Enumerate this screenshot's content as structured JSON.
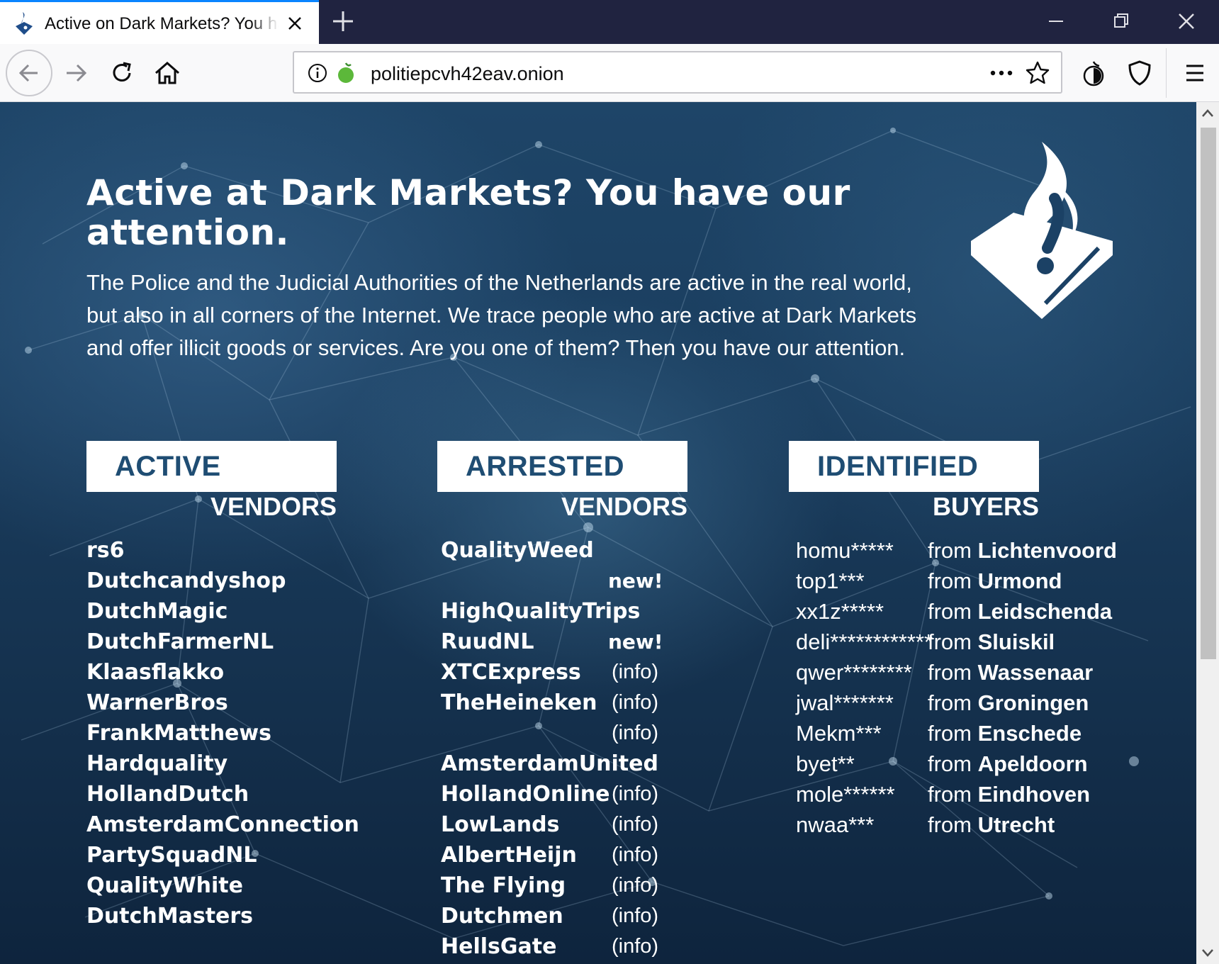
{
  "browser": {
    "tab_title": "Active on Dark Markets? You have our attention",
    "url": "politiepcvh42eav.onion",
    "icons": [
      "police-flame-favicon",
      "close-icon",
      "plus-icon",
      "minimize-icon",
      "restore-icon",
      "close-window-icon",
      "back-arrow-icon",
      "forward-arrow-icon",
      "reload-icon",
      "home-icon",
      "info-icon",
      "onion-icon",
      "more-actions-icon",
      "bookmark-star-icon",
      "tor-circuit-icon",
      "shield-icon",
      "hamburger-menu-icon"
    ],
    "accent_color": "#0a84ff"
  },
  "page": {
    "headline": "Active at Dark Markets? You have our attention.",
    "intro": "The Police and the Judicial Authorities of the Netherlands are active in the real world, but also in all corners of the Internet. We trace people who are active at Dark Markets and offer illicit goods or services. Are you one of them? Then you have our attention.",
    "logo": "dutch-police-flame-logo",
    "columns": {
      "active": {
        "box": "ACTIVE",
        "sub": "VENDORS"
      },
      "arrested": {
        "box": "ARRESTED",
        "sub": "VENDORS"
      },
      "identified": {
        "box": "IDENTIFIED",
        "sub": "BUYERS"
      }
    },
    "active_vendors": [
      "rs6",
      "Dutchcandyshop",
      "DutchMagic",
      "DutchFarmerNL",
      "Klaasflakko",
      "WarnerBros",
      "FrankMatthews",
      "Hardquality",
      "HollandDutch",
      "AmsterdamConnection",
      "PartySquadNL",
      "QualityWhite",
      "DutchMasters"
    ],
    "arrested_vendors": [
      {
        "name": "QualityWeed",
        "note": "",
        "new": ""
      },
      {
        "name": "",
        "note": "",
        "new": "new!"
      },
      {
        "name": "HighQualityTrips",
        "note": "",
        "new": ""
      },
      {
        "name": "RuudNL",
        "note": "",
        "new": "new!"
      },
      {
        "name": "XTCExpress",
        "note": "(info)",
        "new": ""
      },
      {
        "name": "TheHeineken",
        "note": "(info)",
        "new": ""
      },
      {
        "name": "",
        "note": "(info)",
        "new": ""
      },
      {
        "name": "AmsterdamUnited",
        "note": "",
        "new": ""
      },
      {
        "name": "HollandOnline",
        "note": "(info)",
        "new": ""
      },
      {
        "name": "LowLands",
        "note": "(info)",
        "new": ""
      },
      {
        "name": "AlbertHeijn",
        "note": "(info)",
        "new": ""
      },
      {
        "name": "The Flying",
        "note": "(info)",
        "new": ""
      },
      {
        "name": "Dutchmen",
        "note": "(info)",
        "new": ""
      },
      {
        "name": "HellsGate",
        "note": "(info)",
        "new": ""
      }
    ],
    "identified_buyers": [
      {
        "handle": "homu*****",
        "from": "from",
        "city": "Lichtenvoord"
      },
      {
        "handle": "top1***",
        "from": "from",
        "city": "Urmond"
      },
      {
        "handle": "xx1z*****",
        "from": "from",
        "city": "Leidschenda"
      },
      {
        "handle": "deli************",
        "from": "from",
        "city": "Sluiskil"
      },
      {
        "handle": "qwer********",
        "from": "from",
        "city": "Wassenaar"
      },
      {
        "handle": "jwal*******",
        "from": "from",
        "city": "Groningen"
      },
      {
        "handle": "Mekm***",
        "from": "from",
        "city": "Enschede"
      },
      {
        "handle": "byet**",
        "from": "from",
        "city": "Apeldoorn"
      },
      {
        "handle": "mole******",
        "from": "from",
        "city": "Eindhoven"
      },
      {
        "handle": "nwaa***",
        "from": "from",
        "city": "Utrecht"
      }
    ],
    "colors": {
      "box_text": "#1f4d73",
      "background_dark": "#15324f"
    }
  }
}
